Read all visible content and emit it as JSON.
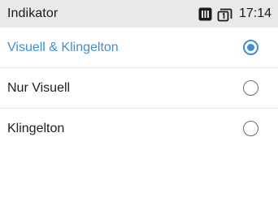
{
  "status_bar": {
    "title": "Indikator",
    "time": "17:14",
    "icons": [
      "sim-card-icon",
      "window-one-icon"
    ]
  },
  "options": [
    {
      "label": "Visuell & Klingelton",
      "selected": true
    },
    {
      "label": "Nur Visuell",
      "selected": false
    },
    {
      "label": "Klingelton",
      "selected": false
    }
  ],
  "colors": {
    "accent": "#3f8ed6",
    "status_bar_bg": "#e9e9e9",
    "text": "#202020"
  }
}
